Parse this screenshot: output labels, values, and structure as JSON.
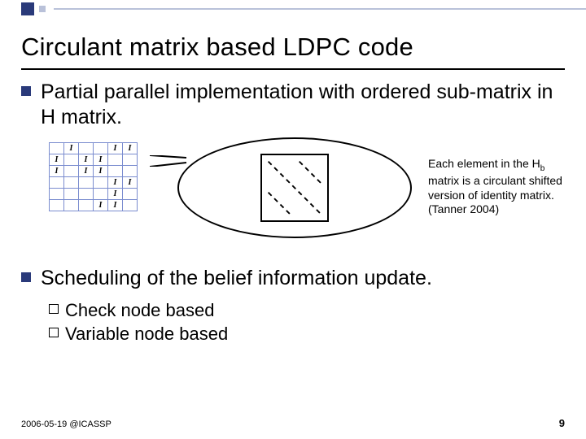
{
  "title": "Circulant matrix based LDPC code",
  "bullet1": "Partial parallel implementation with ordered sub-matrix in H matrix.",
  "caption_pre": "Each element in the H",
  "caption_sub": "b",
  "caption_post": " matrix is a circulant shifted version of identity matrix. (Tanner 2004)",
  "bullet2": "Scheduling of the belief information update.",
  "sub1": "Check node based",
  "sub2": "Variable node based",
  "footer_left": "2006-05-19 @ICASSP",
  "page": "9",
  "matrix": {
    "cols": 6,
    "cells": [
      [
        0,
        1,
        0,
        0,
        1,
        1
      ],
      [
        1,
        0,
        1,
        1,
        0,
        0
      ],
      [
        1,
        0,
        1,
        1,
        0,
        0
      ],
      [
        0,
        0,
        0,
        0,
        1,
        1
      ],
      [
        0,
        0,
        0,
        0,
        1,
        0
      ],
      [
        0,
        0,
        0,
        1,
        1,
        0
      ]
    ]
  }
}
